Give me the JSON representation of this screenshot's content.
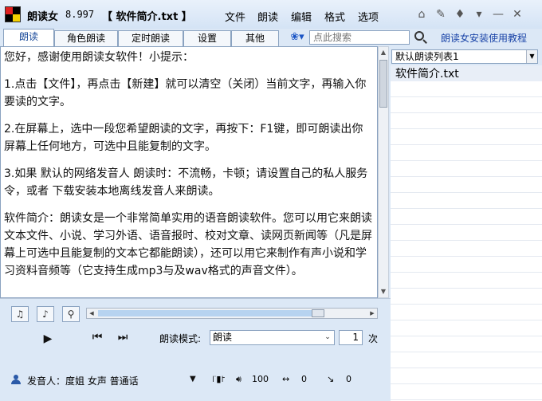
{
  "titlebar": {
    "app_name": "朗读女",
    "version": "8.997",
    "document_title": "【 软件简介.txt 】",
    "menu": [
      "文件",
      "朗读",
      "编辑",
      "格式",
      "选项"
    ]
  },
  "tabs": [
    "朗读",
    "角色朗读",
    "定时朗读",
    "设置",
    "其他"
  ],
  "search": {
    "placeholder": "点此搜索"
  },
  "tutorial_link": "朗读女安装使用教程",
  "content": {
    "paragraphs": [
      "您好，感谢使用朗读女软件！小提示：",
      "1.点击【文件】，再点击【新建】就可以清空（关闭）当前文字，再输入你要读的文字。",
      "2.在屏幕上，选中一段您希望朗读的文字，再按下：F1键，即可朗读出你屏幕上任何地方，可选中且能复制的文字。",
      "3.如果 默认的网络发音人 朗读时：不流畅，卡顿；请设置自己的私人服务令，或者 下载安装本地离线发音人来朗读。",
      "软件简介：朗读女是一个非常简单实用的语音朗读软件。您可以用它来朗读文本文件、小说、学习外语、语音报时、校对文章、读网页新闻等（凡是屏幕上可选中且能复制的文本它都能朗读），还可以用它来制作有声小说和学习资料音频等（它支持生成mp3与及wav格式的声音文件）。"
    ]
  },
  "playlist": {
    "selected_list": "默认朗读列表1",
    "items": [
      "软件简介.txt"
    ]
  },
  "controls": {
    "mode_label": "朗读模式:",
    "mode_value": "朗读",
    "repeat_count": "1",
    "repeat_unit": "次",
    "progress": 0.82
  },
  "voice": {
    "label": "发音人：度姐 女声 普通话",
    "volume": "100",
    "speed": "0",
    "pitch": "0"
  }
}
